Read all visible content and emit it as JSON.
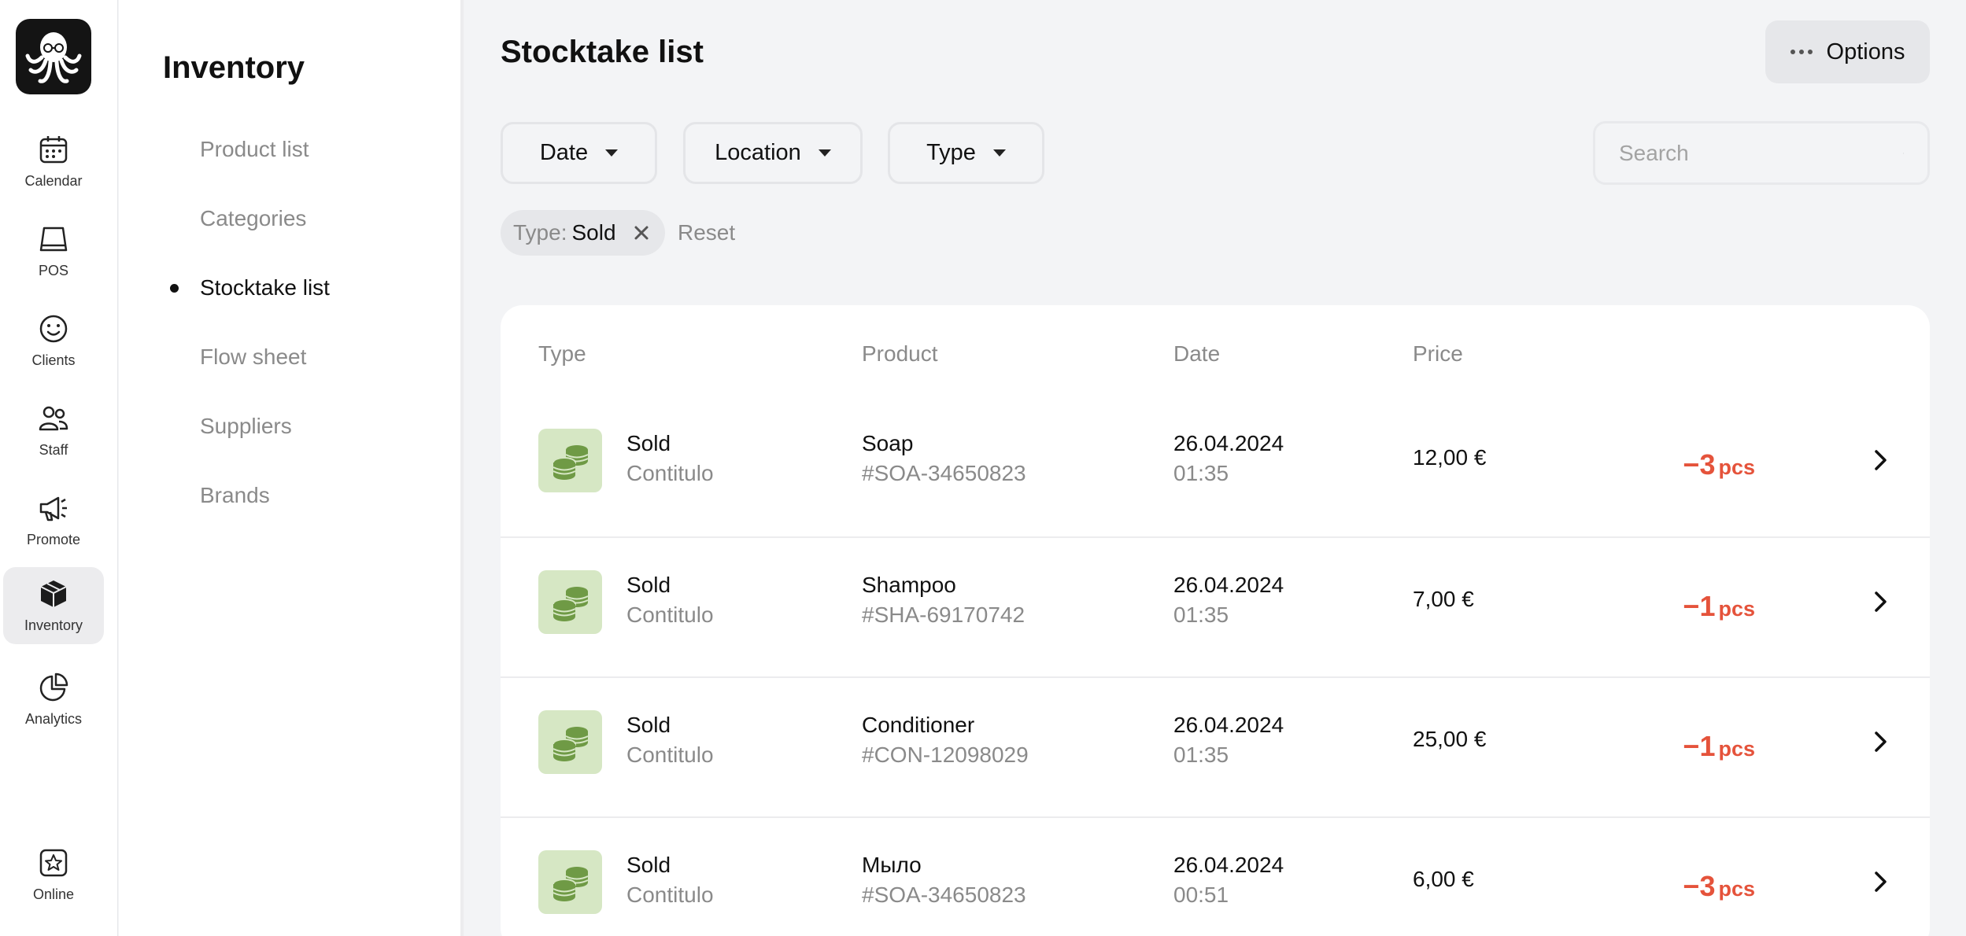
{
  "rail": {
    "items": [
      {
        "label": "Calendar",
        "icon": "calendar-icon"
      },
      {
        "label": "POS",
        "icon": "pos-icon"
      },
      {
        "label": "Clients",
        "icon": "smiley-icon"
      },
      {
        "label": "Staff",
        "icon": "staff-icon"
      },
      {
        "label": "Promote",
        "icon": "megaphone-icon"
      },
      {
        "label": "Inventory",
        "icon": "box-icon",
        "active": true
      },
      {
        "label": "Analytics",
        "icon": "pie-chart-icon"
      },
      {
        "label": "Online",
        "icon": "star-icon"
      }
    ]
  },
  "subnav": {
    "title": "Inventory",
    "items": [
      {
        "label": "Product list"
      },
      {
        "label": "Categories"
      },
      {
        "label": "Stocktake list",
        "active": true
      },
      {
        "label": "Flow sheet"
      },
      {
        "label": "Suppliers"
      },
      {
        "label": "Brands"
      }
    ]
  },
  "header": {
    "title": "Stocktake list",
    "options_label": "Options"
  },
  "filters": {
    "date": "Date",
    "location": "Location",
    "type": "Type",
    "search_placeholder": "Search"
  },
  "active_filter": {
    "key": "Type:",
    "value": "Sold",
    "reset_label": "Reset"
  },
  "table": {
    "headers": {
      "type": "Type",
      "product": "Product",
      "date": "Date",
      "price": "Price"
    },
    "rows": [
      {
        "type": "Sold",
        "location": "Contitulo",
        "product": "Soap",
        "sku": "#SOA-34650823",
        "date": "26.04.2024",
        "time": "01:35",
        "price": "12,00 €",
        "qty": "−3",
        "unit": "pcs"
      },
      {
        "type": "Sold",
        "location": "Contitulo",
        "product": "Shampoo",
        "sku": "#SHA-69170742",
        "date": "26.04.2024",
        "time": "01:35",
        "price": "7,00 €",
        "qty": "−1",
        "unit": "pcs"
      },
      {
        "type": "Sold",
        "location": "Contitulo",
        "product": "Conditioner",
        "sku": "#CON-12098029",
        "date": "26.04.2024",
        "time": "01:35",
        "price": "25,00 €",
        "qty": "−1",
        "unit": "pcs"
      },
      {
        "type": "Sold",
        "location": "Contitulo",
        "product": "Мыло",
        "sku": "#SOA-34650823",
        "date": "26.04.2024",
        "time": "00:51",
        "price": "6,00 €",
        "qty": "−3",
        "unit": "pcs"
      }
    ]
  },
  "colors": {
    "accent_negative": "#e5533b",
    "icon_bg": "#d6e7c4",
    "icon_fg": "#6f9a45"
  }
}
